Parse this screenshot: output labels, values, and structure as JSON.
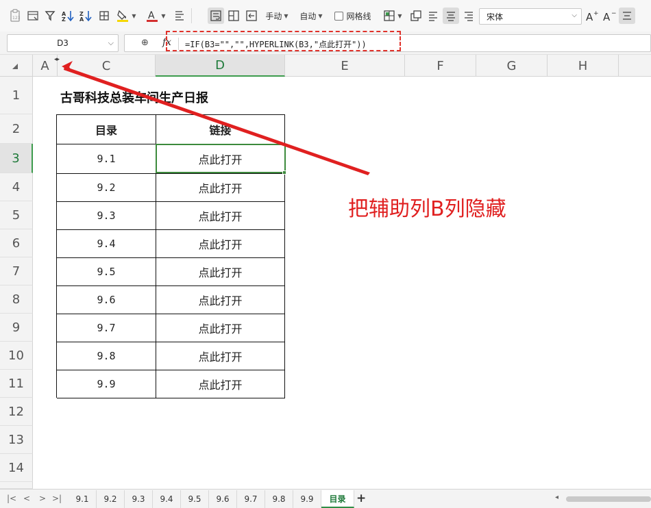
{
  "toolbar": {
    "wrap_label": "手动",
    "auto_label": "自动",
    "gridlines_label": "网格线",
    "font_name": "宋体",
    "font_color": "#d32f2f",
    "highlight_color": "#f5d700"
  },
  "formula_bar": {
    "name_box": "D3",
    "fx_label": "fx",
    "formula": "=IF(B3=\"\",\"\",HYPERLINK(B3,\"点此打开\"))"
  },
  "columns": [
    "A",
    "C",
    "D",
    "E",
    "F",
    "G",
    "H"
  ],
  "rows": [
    "1",
    "2",
    "3",
    "4",
    "5",
    "6",
    "7",
    "8",
    "9",
    "10",
    "11",
    "12",
    "13",
    "14"
  ],
  "selected_cell": "D3",
  "sheet": {
    "title": "古哥科技总装车间生产日报",
    "table": {
      "headers": [
        "目录",
        "链接"
      ],
      "rows": [
        [
          "9.1",
          "点此打开"
        ],
        [
          "9.2",
          "点此打开"
        ],
        [
          "9.3",
          "点此打开"
        ],
        [
          "9.4",
          "点此打开"
        ],
        [
          "9.5",
          "点此打开"
        ],
        [
          "9.6",
          "点此打开"
        ],
        [
          "9.7",
          "点此打开"
        ],
        [
          "9.8",
          "点此打开"
        ],
        [
          "9.9",
          "点此打开"
        ]
      ]
    }
  },
  "annotation": {
    "text": "把辅助列B列隐藏",
    "color": "#e02020"
  },
  "sheet_tabs": [
    "9.1",
    "9.2",
    "9.3",
    "9.4",
    "9.5",
    "9.6",
    "9.7",
    "9.8",
    "9.9",
    "目录"
  ],
  "active_tab": "目录",
  "accent_color": "#2f8f46"
}
